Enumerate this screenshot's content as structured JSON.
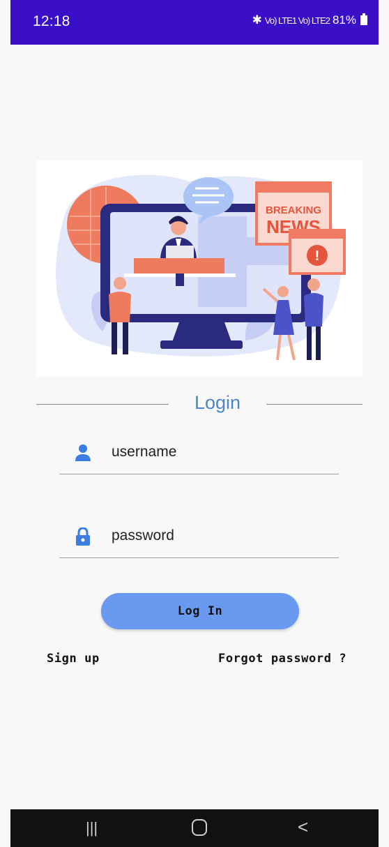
{
  "status_bar": {
    "time": "12:18",
    "signal_text": "Vo) LTE1 Vo) LTE2",
    "battery": "81%"
  },
  "illustration": {
    "badge_line1": "BREAKING",
    "badge_line2": "NEWS",
    "exclamation": "!"
  },
  "login": {
    "title": "Login",
    "username_label": "username",
    "password_label": "password",
    "button_label": "Log In",
    "signup_label": "Sign up",
    "forgot_label": "Forgot password ?"
  },
  "nav": {
    "recent_symbol": "|||",
    "back_symbol": "<"
  },
  "colors": {
    "status_bar": "#3a0fc7",
    "accent": "#4a86c8",
    "button": "#6a9af0",
    "icon_blue": "#3b7de0"
  }
}
